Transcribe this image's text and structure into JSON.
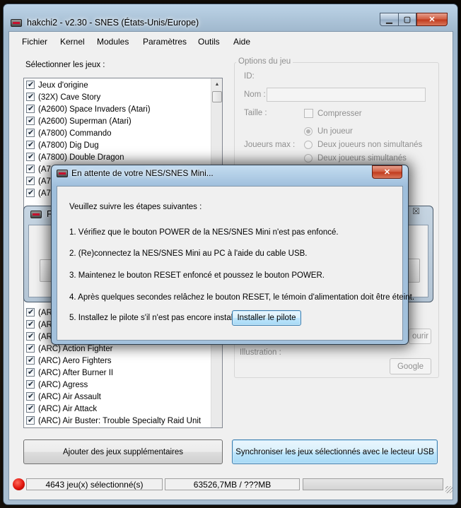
{
  "window": {
    "title": "hakchi2 - v2.30 - SNES (États-Unis/Europe)",
    "caption_buttons": {
      "minimize_icon": "minimize-icon",
      "maximize_icon": "maximize-icon",
      "close_icon": "close-icon"
    }
  },
  "menu": [
    "Fichier",
    "Kernel",
    "Modules",
    "Paramètres",
    "Outils",
    "Aide"
  ],
  "games": {
    "label": "Sélectionner les jeux :",
    "items_top": [
      "Jeux d'origine",
      "(32X) Cave Story",
      "(A2600) Space Invaders (Atari)",
      "(A2600) Superman (Atari)",
      "(A7800) Commando",
      "(A7800) Dig Dug",
      "(A7800) Double Dragon",
      "(A7",
      "(A7",
      "(A7"
    ],
    "items_bottom": [
      "(AR",
      "(AR",
      "(AR",
      "(ARC) Action Fighter",
      "(ARC) Aero Fighters",
      "(ARC) After Burner II",
      "(ARC) Agress",
      "(ARC) Air Assault",
      "(ARC) Air Attack",
      "(ARC) Air Buster: Trouble Specialty Raid Unit"
    ]
  },
  "options": {
    "legend": "Options du jeu",
    "id_label": "ID:",
    "name_label": "Nom :",
    "size_label": "Taille :",
    "compress_label": "Compresser",
    "max_players_label": "Joueurs max :",
    "radio_one": "Un joueur",
    "radio_two_nonsim": "Deux joueurs non simultanés",
    "radio_two_sim": "Deux joueurs simultanés",
    "illustration_label": "Illustration :",
    "browse_fragment": "ourir",
    "google_button": "Google"
  },
  "buttons": {
    "add_games": "Ajouter des jeux supplémentaires",
    "sync": "Synchroniser les jeux sélectionnés avec le lecteur USB"
  },
  "status": {
    "selected": "4643 jeu(x) sélectionné(s)",
    "size": "63526,7MB / ???MB",
    "indicator_color": "#e0140c"
  },
  "background_dialog": {
    "title_fragment": "F"
  },
  "wait_dialog": {
    "title": "En attente de votre NES/SNES Mini...",
    "intro": "Veuillez suivre les étapes suivantes :",
    "step1": "1. Vérifiez que le bouton POWER de la NES/SNES Mini n'est pas enfoncé.",
    "step2": "2. (Re)connectez la NES/SNES Mini au PC à l'aide du cable USB.",
    "step3": "3. Maintenez le bouton RESET enfoncé et poussez le bouton POWER.",
    "step4": "4. Après quelques secondes relâchez le bouton RESET, le témoin d'alimentation doit être éteint.",
    "step5": "5. Installez le pilote s'il n'est pas encore installé :",
    "install_button": "Installer le pilote"
  }
}
